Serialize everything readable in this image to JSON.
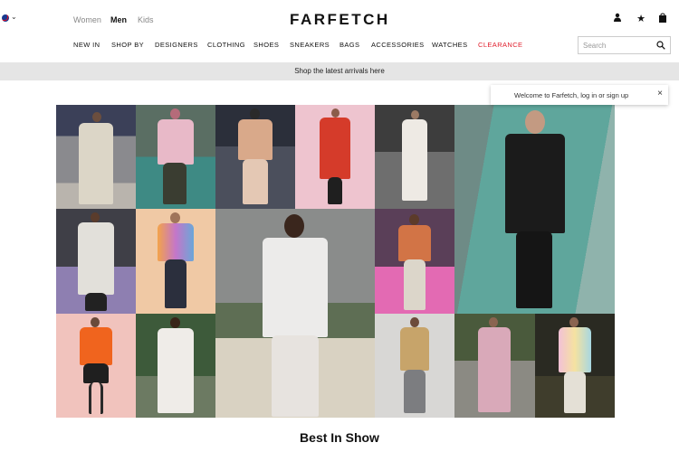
{
  "header": {
    "genders": [
      "Women",
      "Men",
      "Kids"
    ],
    "active_gender": "Men",
    "logo": "FARFETCH"
  },
  "nav": {
    "items": [
      "NEW IN",
      "SHOP BY",
      "DESIGNERS",
      "CLOTHING",
      "SHOES",
      "SNEAKERS",
      "BAGS",
      "ACCESSORIES",
      "WATCHES",
      "CLEARANCE"
    ]
  },
  "search": {
    "placeholder": "Search"
  },
  "banner": {
    "text": "Shop the latest arrivals here"
  },
  "tooltip": {
    "text": "Welcome to Farfetch, log in or sign up",
    "close": "×"
  },
  "section": {
    "title": "Best In Show"
  },
  "colors": {
    "sale": "#e0202e",
    "banner_bg": "#e5e5e5"
  },
  "icons": [
    "flag-icon",
    "user-icon",
    "star-icon",
    "bag-icon",
    "search-icon",
    "close-icon"
  ]
}
